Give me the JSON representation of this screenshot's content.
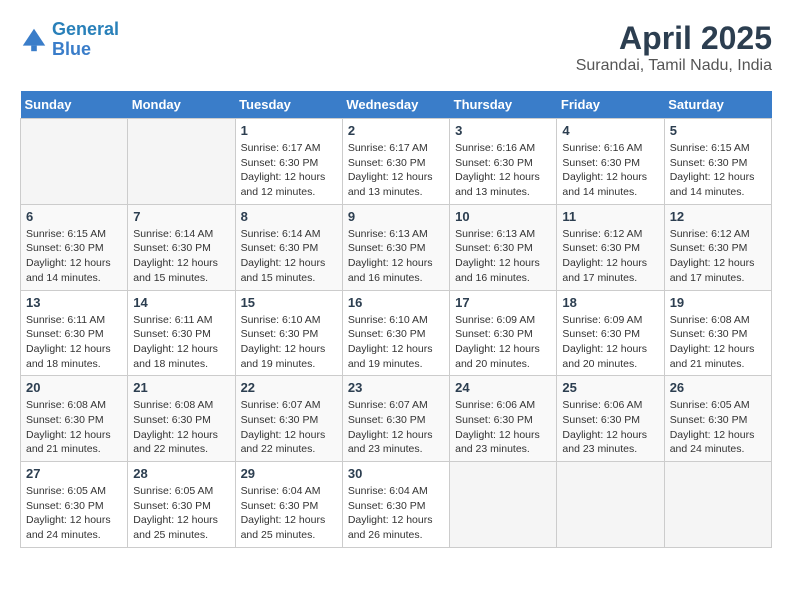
{
  "header": {
    "logo_line1": "General",
    "logo_line2": "Blue",
    "title": "April 2025",
    "subtitle": "Surandai, Tamil Nadu, India"
  },
  "weekdays": [
    "Sunday",
    "Monday",
    "Tuesday",
    "Wednesday",
    "Thursday",
    "Friday",
    "Saturday"
  ],
  "weeks": [
    [
      {
        "num": "",
        "info": ""
      },
      {
        "num": "",
        "info": ""
      },
      {
        "num": "1",
        "info": "Sunrise: 6:17 AM\nSunset: 6:30 PM\nDaylight: 12 hours\nand 12 minutes."
      },
      {
        "num": "2",
        "info": "Sunrise: 6:17 AM\nSunset: 6:30 PM\nDaylight: 12 hours\nand 13 minutes."
      },
      {
        "num": "3",
        "info": "Sunrise: 6:16 AM\nSunset: 6:30 PM\nDaylight: 12 hours\nand 13 minutes."
      },
      {
        "num": "4",
        "info": "Sunrise: 6:16 AM\nSunset: 6:30 PM\nDaylight: 12 hours\nand 14 minutes."
      },
      {
        "num": "5",
        "info": "Sunrise: 6:15 AM\nSunset: 6:30 PM\nDaylight: 12 hours\nand 14 minutes."
      }
    ],
    [
      {
        "num": "6",
        "info": "Sunrise: 6:15 AM\nSunset: 6:30 PM\nDaylight: 12 hours\nand 14 minutes."
      },
      {
        "num": "7",
        "info": "Sunrise: 6:14 AM\nSunset: 6:30 PM\nDaylight: 12 hours\nand 15 minutes."
      },
      {
        "num": "8",
        "info": "Sunrise: 6:14 AM\nSunset: 6:30 PM\nDaylight: 12 hours\nand 15 minutes."
      },
      {
        "num": "9",
        "info": "Sunrise: 6:13 AM\nSunset: 6:30 PM\nDaylight: 12 hours\nand 16 minutes."
      },
      {
        "num": "10",
        "info": "Sunrise: 6:13 AM\nSunset: 6:30 PM\nDaylight: 12 hours\nand 16 minutes."
      },
      {
        "num": "11",
        "info": "Sunrise: 6:12 AM\nSunset: 6:30 PM\nDaylight: 12 hours\nand 17 minutes."
      },
      {
        "num": "12",
        "info": "Sunrise: 6:12 AM\nSunset: 6:30 PM\nDaylight: 12 hours\nand 17 minutes."
      }
    ],
    [
      {
        "num": "13",
        "info": "Sunrise: 6:11 AM\nSunset: 6:30 PM\nDaylight: 12 hours\nand 18 minutes."
      },
      {
        "num": "14",
        "info": "Sunrise: 6:11 AM\nSunset: 6:30 PM\nDaylight: 12 hours\nand 18 minutes."
      },
      {
        "num": "15",
        "info": "Sunrise: 6:10 AM\nSunset: 6:30 PM\nDaylight: 12 hours\nand 19 minutes."
      },
      {
        "num": "16",
        "info": "Sunrise: 6:10 AM\nSunset: 6:30 PM\nDaylight: 12 hours\nand 19 minutes."
      },
      {
        "num": "17",
        "info": "Sunrise: 6:09 AM\nSunset: 6:30 PM\nDaylight: 12 hours\nand 20 minutes."
      },
      {
        "num": "18",
        "info": "Sunrise: 6:09 AM\nSunset: 6:30 PM\nDaylight: 12 hours\nand 20 minutes."
      },
      {
        "num": "19",
        "info": "Sunrise: 6:08 AM\nSunset: 6:30 PM\nDaylight: 12 hours\nand 21 minutes."
      }
    ],
    [
      {
        "num": "20",
        "info": "Sunrise: 6:08 AM\nSunset: 6:30 PM\nDaylight: 12 hours\nand 21 minutes."
      },
      {
        "num": "21",
        "info": "Sunrise: 6:08 AM\nSunset: 6:30 PM\nDaylight: 12 hours\nand 22 minutes."
      },
      {
        "num": "22",
        "info": "Sunrise: 6:07 AM\nSunset: 6:30 PM\nDaylight: 12 hours\nand 22 minutes."
      },
      {
        "num": "23",
        "info": "Sunrise: 6:07 AM\nSunset: 6:30 PM\nDaylight: 12 hours\nand 23 minutes."
      },
      {
        "num": "24",
        "info": "Sunrise: 6:06 AM\nSunset: 6:30 PM\nDaylight: 12 hours\nand 23 minutes."
      },
      {
        "num": "25",
        "info": "Sunrise: 6:06 AM\nSunset: 6:30 PM\nDaylight: 12 hours\nand 23 minutes."
      },
      {
        "num": "26",
        "info": "Sunrise: 6:05 AM\nSunset: 6:30 PM\nDaylight: 12 hours\nand 24 minutes."
      }
    ],
    [
      {
        "num": "27",
        "info": "Sunrise: 6:05 AM\nSunset: 6:30 PM\nDaylight: 12 hours\nand 24 minutes."
      },
      {
        "num": "28",
        "info": "Sunrise: 6:05 AM\nSunset: 6:30 PM\nDaylight: 12 hours\nand 25 minutes."
      },
      {
        "num": "29",
        "info": "Sunrise: 6:04 AM\nSunset: 6:30 PM\nDaylight: 12 hours\nand 25 minutes."
      },
      {
        "num": "30",
        "info": "Sunrise: 6:04 AM\nSunset: 6:30 PM\nDaylight: 12 hours\nand 26 minutes."
      },
      {
        "num": "",
        "info": ""
      },
      {
        "num": "",
        "info": ""
      },
      {
        "num": "",
        "info": ""
      }
    ]
  ]
}
